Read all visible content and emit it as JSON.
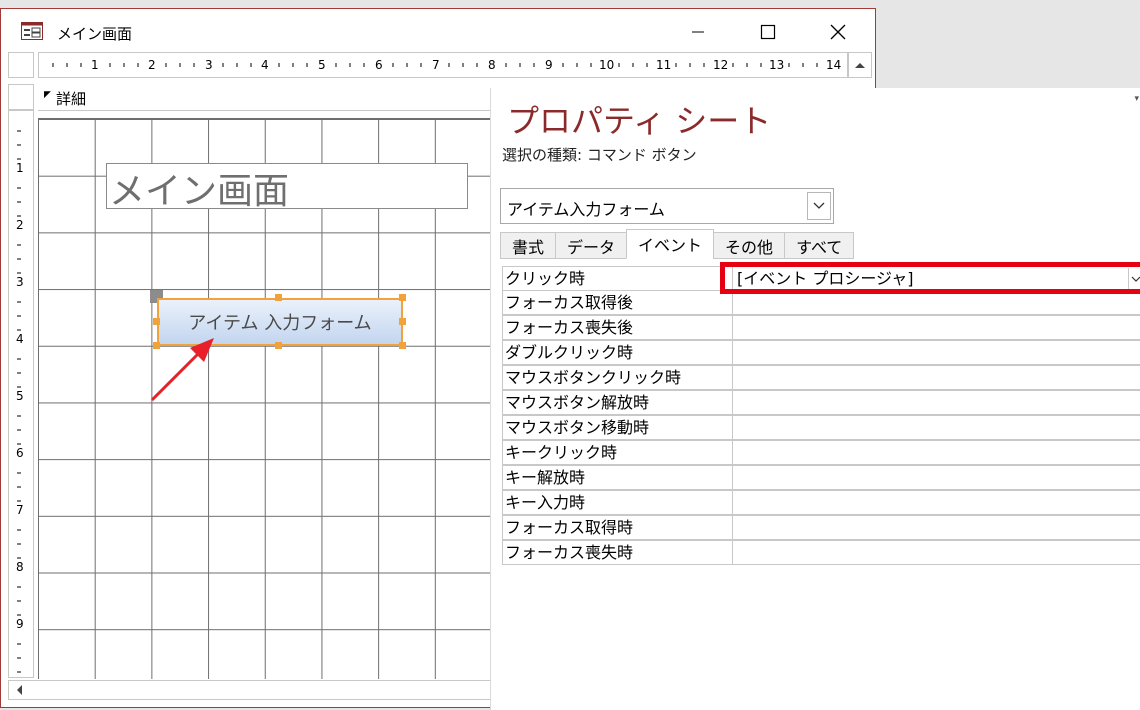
{
  "window": {
    "title": "メイン画面",
    "controls": {
      "minimize": "minimize-icon",
      "maximize": "maximize-icon",
      "close": "close-icon"
    }
  },
  "ruler": {
    "horizontal": [
      "1",
      "2",
      "3",
      "4",
      "5",
      "6",
      "7",
      "8",
      "9",
      "10",
      "11",
      "12",
      "13",
      "14"
    ],
    "vertical": [
      "1",
      "2",
      "3",
      "4",
      "5",
      "6",
      "7",
      "8",
      "9"
    ]
  },
  "design": {
    "section_label": "詳細",
    "form_label": "メイン画面",
    "command_button_label": "アイテム 入力フォーム"
  },
  "property_sheet": {
    "title": "プロパティ シート",
    "selection_type": "選択の種類: コマンド ボタン",
    "object_combo": "アイテム入力フォーム",
    "tabs": [
      "書式",
      "データ",
      "イベント",
      "その他",
      "すべて"
    ],
    "active_tab": "イベント",
    "rows": [
      {
        "name": "クリック時",
        "value": "[イベント プロシージャ]"
      },
      {
        "name": "フォーカス取得後",
        "value": ""
      },
      {
        "name": "フォーカス喪失後",
        "value": ""
      },
      {
        "name": "ダブルクリック時",
        "value": ""
      },
      {
        "name": "マウスボタンクリック時",
        "value": ""
      },
      {
        "name": "マウスボタン解放時",
        "value": ""
      },
      {
        "name": "マウスボタン移動時",
        "value": ""
      },
      {
        "name": "キークリック時",
        "value": ""
      },
      {
        "name": "キー解放時",
        "value": ""
      },
      {
        "name": "キー入力時",
        "value": ""
      },
      {
        "name": "フォーカス取得時",
        "value": ""
      },
      {
        "name": "フォーカス喪失時",
        "value": ""
      }
    ]
  },
  "colors": {
    "highlight_box": "#e50012",
    "arrow": "#e8202a",
    "selection_handles": "#f2a23b",
    "title_accent": "#8b2a2a"
  }
}
